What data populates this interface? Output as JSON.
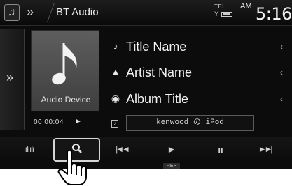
{
  "header": {
    "source_icon": "music-note-icon",
    "nav_chevron": "»",
    "title": "BT Audio",
    "tel_label": "TEL",
    "band": "AM",
    "clock": "5:16"
  },
  "side_tab": {
    "label": "»"
  },
  "artwork": {
    "device_label": "Audio Device"
  },
  "playback": {
    "elapsed": "00:00:04",
    "state_icon": "►"
  },
  "track": {
    "title": "Title Name",
    "artist": "Artist Name",
    "album": "Album Title"
  },
  "row_icons": {
    "title": "♪",
    "artist": "▲",
    "album": "◉",
    "scroll": "‹"
  },
  "device": {
    "name": "kenwood の iPod"
  },
  "controls": {
    "eq_glyph": "ılıılı",
    "prev_glyph": "|◄◄",
    "play_glyph": "►",
    "pause_glyph": "ıı",
    "next_glyph": "►►|"
  },
  "badges": {
    "repeat": "REP"
  },
  "colors": {
    "background": "#0c0c0c",
    "text": "#f4f4f4",
    "accent_border": "#d6d6d6"
  }
}
